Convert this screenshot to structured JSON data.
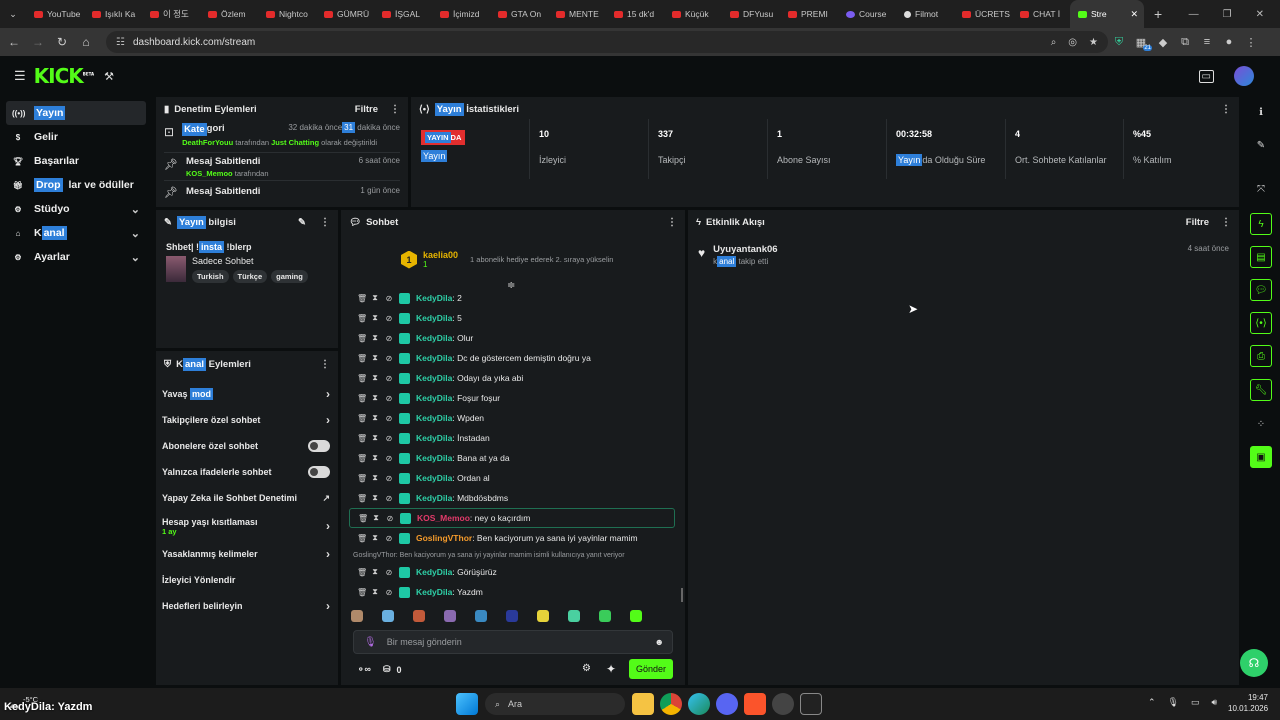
{
  "browser": {
    "tabs": [
      {
        "label": "YouTube",
        "fav": "y"
      },
      {
        "label": "Işıklı Ka",
        "fav": "y"
      },
      {
        "label": "이 정도",
        "fav": "y"
      },
      {
        "label": "Özlem",
        "fav": "y"
      },
      {
        "label": "Nightco",
        "fav": "y"
      },
      {
        "label": "GÜMRÜ",
        "fav": "y"
      },
      {
        "label": "İŞGAL",
        "fav": "y"
      },
      {
        "label": "İçimizd",
        "fav": "y"
      },
      {
        "label": "GTA On",
        "fav": "y"
      },
      {
        "label": "MENTE",
        "fav": "y"
      },
      {
        "label": "15 dk'd",
        "fav": "y"
      },
      {
        "label": "Küçük",
        "fav": "y"
      },
      {
        "label": "DFYusu",
        "fav": "y"
      },
      {
        "label": "PREMI",
        "fav": "y"
      },
      {
        "label": "Course",
        "fav": "c"
      },
      {
        "label": "Filmot",
        "fav": "f"
      },
      {
        "label": "ÜCRETS",
        "fav": "y"
      },
      {
        "label": "CHAT İ",
        "fav": "y"
      }
    ],
    "active_tab": "Stre",
    "new_tab": "+",
    "url": "dashboard.kick.com/stream",
    "ext_badge": "21"
  },
  "header": {
    "logo": "KICK",
    "logo_sup": "BETA"
  },
  "sidebar": {
    "items": [
      {
        "label": "Yayın",
        "icon": "broadcast-icon",
        "active": true
      },
      {
        "label": "Gelir",
        "icon": "money-icon"
      },
      {
        "label": "Başarılar",
        "icon": "trophy-icon"
      },
      {
        "label_sel": "Drop",
        "label_rest": "lar ve ödüller",
        "icon": "gift-icon"
      },
      {
        "label": "Stüdyo",
        "icon": "studio-icon",
        "chevron": true
      },
      {
        "label_pre": "K",
        "label_sel": "anal",
        "icon": "channel-icon",
        "chevron": true
      },
      {
        "label": "Ayarlar",
        "icon": "gear-icon",
        "chevron": true
      }
    ]
  },
  "audit": {
    "title": "Denetim Eylemleri",
    "filter": "Filtre",
    "rows": [
      {
        "title_sel": "Kate",
        "title_rest": "gori",
        "time_pre": "32 dakika önce",
        "time_sel": "31",
        "time_post": " dakika önce",
        "user": "DeathForYouu",
        "mid": " tarafından ",
        "val": "Just Chatting",
        "post": " olarak değiştirildi"
      },
      {
        "title": "Mesaj Sabitlendi",
        "time": "6 saat önce",
        "user": "KOS_Memoo",
        "mid": " tarafından"
      },
      {
        "title": "Mesaj Sabitlendi",
        "time": "1 gün önce"
      }
    ]
  },
  "stats": {
    "title_sel": "Yayın",
    "title_rest": " İstatistikleri",
    "live_badge_sel": "YAYIN",
    "live_badge_rest": "DA",
    "live_label": "Yayın",
    "items": [
      {
        "value": "10",
        "label": "İzleyici"
      },
      {
        "value": "337",
        "label": "Takipçi"
      },
      {
        "value": "1",
        "label": "Abone Sayısı"
      },
      {
        "value": "00:32:58",
        "label_sel": "Yayın",
        "label_rest": "da Olduğu Süre"
      },
      {
        "value": "4",
        "label": "Ort. Sohbete Katılanlar"
      },
      {
        "value": "%45",
        "label": "% Katılım"
      }
    ]
  },
  "stream_info": {
    "title_sel": "Yayın",
    "title_rest": " bilgisi",
    "stream_title_pre": "Shbet| !",
    "stream_title_sel": "insta",
    "stream_title_post": " !blerp",
    "category": "Sadece Sohbet",
    "tags": [
      "Turkish",
      "Türkçe",
      "gaming"
    ]
  },
  "channel_actions": {
    "title_pre": "K",
    "title_sel": "anal",
    "title_rest": " Eylemleri",
    "items": [
      {
        "pre": "Yavaş ",
        "sel": "mod",
        "ctrl": "arrow"
      },
      {
        "label": "Takipçilere özel sohbet",
        "ctrl": "arrow"
      },
      {
        "label": "Abonelere özel sohbet",
        "ctrl": "toggle"
      },
      {
        "label": "Yalnızca ifadelerle sohbet",
        "ctrl": "toggle"
      },
      {
        "label": "Yapay Zeka ile Sohbet Denetimi",
        "ctrl": "external"
      },
      {
        "label": "Hesap yaşı kısıtlaması",
        "sub": "1 ay",
        "ctrl": "arrow"
      },
      {
        "label": "Yasaklanmış kelimeler",
        "ctrl": "arrow"
      },
      {
        "label": "İzleyici Yönlendir",
        "ctrl": "none"
      },
      {
        "label": "Hedefleri belirleyin",
        "ctrl": "arrow"
      }
    ]
  },
  "chat": {
    "title": "Sohbet",
    "pinned": {
      "user": "kaelia00",
      "count": "1",
      "badge_num": "1",
      "text": "1 abonelik hediye ederek 2. sıraya yükselin"
    },
    "messages": [
      {
        "user": "KedyDila",
        "text": ": 2"
      },
      {
        "user": "KedyDila",
        "text": ": 5"
      },
      {
        "user": "KedyDila",
        "text": ": Olur"
      },
      {
        "user": "KedyDila",
        "text": ": Dc de göstercem demiştin doğru ya"
      },
      {
        "user": "KedyDila",
        "text": ": Odayı da yıka abi"
      },
      {
        "user": "KedyDila",
        "text": ": Foşur foşur"
      },
      {
        "user": "KedyDila",
        "text": ": Wpden"
      },
      {
        "user": "KedyDila",
        "text": ": İnstadan"
      },
      {
        "user": "KedyDila",
        "text": ": Bana at ya da"
      },
      {
        "user": "KedyDila",
        "text": ": Ordan al"
      },
      {
        "user": "KedyDila",
        "text": ": Mdbdösbdms"
      }
    ],
    "highlight": {
      "user": "KOS_Memoo",
      "text": ": ney o kaçırdım"
    },
    "gosling": {
      "user": "GoslingVThor",
      "text": ": Ben kaciyorum ya sana iyi yayinlar mamim"
    },
    "reply_hint": "GoslingVThor: Ben kaciyorum ya sana iyi yayinlar mamim isimli kullanıcıya yanıt veriyor",
    "after": [
      {
        "user": "KedyDila",
        "text": ": Görüşürüz"
      },
      {
        "user": "KedyDila",
        "text": ": Yazdm"
      }
    ],
    "placeholder": "Bir mesaj gönderin",
    "points": "0",
    "send": "Gönder"
  },
  "activity": {
    "title": "Etkinlik Akışı",
    "filter": "Filtre",
    "items": [
      {
        "user": "Uyuyantank06",
        "pre": "k",
        "sel": "anal",
        "rest": " takip etti",
        "time": "4 saat önce"
      }
    ]
  },
  "taskbar": {
    "weather": "-5°C",
    "overlay": "KedyDila: Yazdm",
    "search": "Ara",
    "time": "19:47",
    "date": "10.01.2026"
  },
  "colors": {
    "accent": "#53fc18",
    "selection": "#2e7fd9",
    "panel": "#181b1d"
  }
}
